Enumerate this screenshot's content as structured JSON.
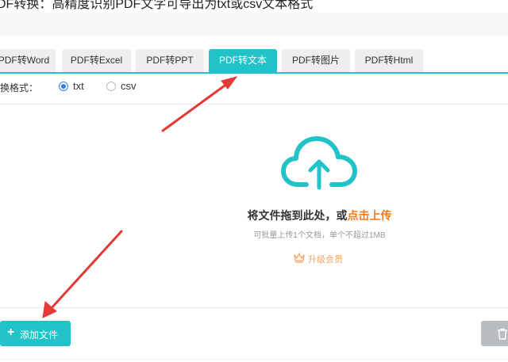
{
  "headline": "DF转换：高精度识别PDF文字可导出为txt或csv文本格式",
  "tabs": [
    {
      "label": "PDF转Word",
      "active": false
    },
    {
      "label": "PDF转Excel",
      "active": false
    },
    {
      "label": "PDF转PPT",
      "active": false
    },
    {
      "label": "PDF转文本",
      "active": true
    },
    {
      "label": "PDF转图片",
      "active": false
    },
    {
      "label": "PDF转Html",
      "active": false
    }
  ],
  "format": {
    "label": "换格式：",
    "options": [
      {
        "label": "txt",
        "checked": true
      },
      {
        "label": "csv",
        "checked": false
      }
    ]
  },
  "dropzone": {
    "title_prefix": "将文件拖到此处，或",
    "title_link": "点击上传",
    "hint": "可批量上传1个文档，单个不超过1MB",
    "upgrade": "升级会员",
    "icon": "cloud-upload-icon"
  },
  "actions": {
    "add_label": "添加文件",
    "add_icon": "plus-icon",
    "delete_icon": "trash-icon"
  },
  "colors": {
    "accent": "#22c3c8",
    "link": "#f47a20",
    "radio": "#2f7ef5",
    "annotation_arrow": "#e53935"
  }
}
